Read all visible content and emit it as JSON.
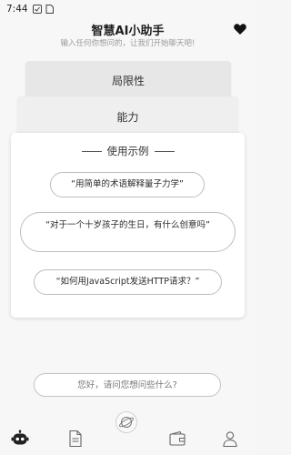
{
  "status_bar": {
    "time": "7:44"
  },
  "header": {
    "title": "智慧AI小助手",
    "subtitle": "输入任何你想问的，让我们开始聊天吧!"
  },
  "cards": {
    "limitations": "局限性",
    "capabilities": "能力",
    "examples": {
      "heading": "使用示例",
      "items": [
        "“用简单的术语解释量子力学”",
        "“对于一个十岁孩子的生日，有什么创意吗”",
        "“如何用JavaScript发送HTTP请求？”"
      ]
    }
  },
  "chat": {
    "placeholder": "您好，请问您想问些什么?"
  },
  "colors": {
    "background": "#f7f7f7",
    "card_back": "#e7e7e7",
    "card_mid": "#efefef",
    "card_front": "#ffffff",
    "border": "#bdbdbd",
    "icon": "#555555"
  },
  "icons": {
    "status": [
      "notification-icon",
      "sim-icon"
    ],
    "header_action": "heart-icon",
    "nav": [
      "robot-icon",
      "document-icon",
      "wallet-icon",
      "person-icon"
    ],
    "center_button": "planet-icon"
  }
}
